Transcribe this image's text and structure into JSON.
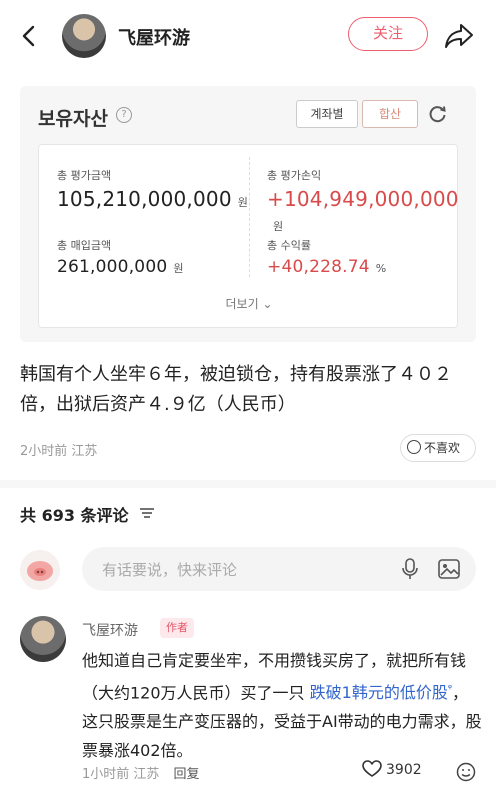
{
  "header": {
    "author": "飞屋环游",
    "follow_label": "关注"
  },
  "card": {
    "title": "보유자산",
    "tab_account": "계좌별",
    "tab_total": "합산",
    "eval_amount_label": "총 평가금액",
    "eval_amount_value": "105,210,000,000",
    "eval_profit_label": "총 평가손익",
    "eval_profit_value": "+104,949,000,000",
    "purchase_label": "총 매입금액",
    "purchase_value": "261,000,000",
    "return_label": "총 수익률",
    "return_value": "+40,228.74",
    "unit_won": "원",
    "unit_pct": "%",
    "more_label": "더보기"
  },
  "post": {
    "text": "韩国有个人坐牢６年，被迫锁仓，持有股票涨了４０２倍，出狱后资产４.９亿（人民币）",
    "time": "2小时前",
    "location": "江苏",
    "dislike_label": "不喜欢"
  },
  "comments": {
    "count_label": "共 693 条评论",
    "input_placeholder": "有话要说，快来评论",
    "items": [
      {
        "author": "飞屋环游",
        "tag": "作者",
        "text_before": "他知道自己肯定要坐牢，不用攒钱买房了，就把所有钱（大约120万人民币）买了一只 ",
        "link": "跌破1韩元的低价股",
        "text_after": "，这只股票是生产变压器的，受益于AI带动的电力需求，股票暴涨402倍。",
        "time": "1小时前",
        "location": "江苏",
        "reply_label": "回复",
        "likes": "3902"
      }
    ]
  },
  "colors": {
    "accent": "#f05d6e",
    "link": "#3366cc",
    "profit_red": "#d94a4a"
  }
}
